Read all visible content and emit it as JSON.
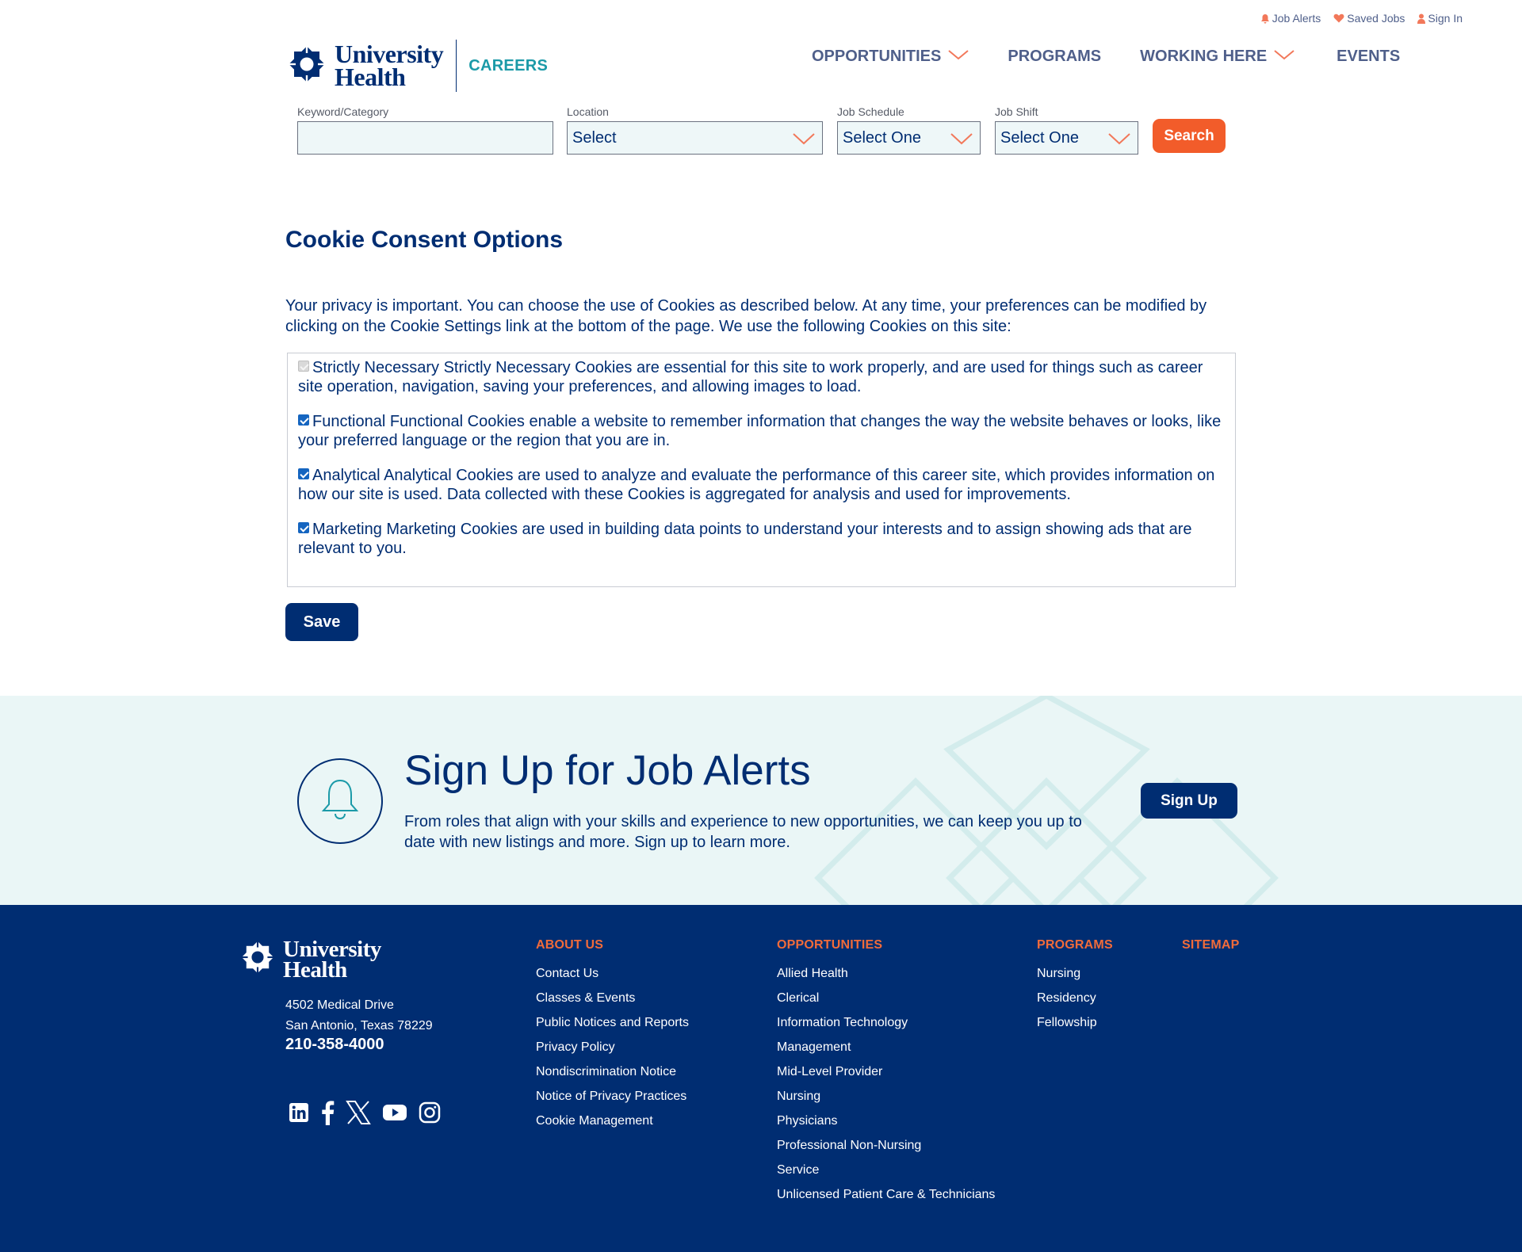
{
  "utility": {
    "job_alerts": "Job Alerts",
    "saved_jobs": "Saved Jobs",
    "sign_in": "Sign In"
  },
  "brand": {
    "name_line1": "University",
    "name_line2": "Health",
    "section": "CAREERS"
  },
  "nav": {
    "items": [
      {
        "label": "OPPORTUNITIES",
        "has_dropdown": true
      },
      {
        "label": "PROGRAMS",
        "has_dropdown": false
      },
      {
        "label": "WORKING HERE",
        "has_dropdown": true
      },
      {
        "label": "EVENTS",
        "has_dropdown": false
      }
    ]
  },
  "search": {
    "keyword": {
      "label": "Keyword/Category",
      "value": ""
    },
    "location": {
      "label": "Location",
      "value": "Select"
    },
    "schedule": {
      "label": "Job Schedule",
      "value": "Select One"
    },
    "shift": {
      "label": "Job Shift",
      "value": "Select One"
    },
    "button": "Search"
  },
  "cookies": {
    "title": "Cookie Consent Options",
    "intro": "Your privacy is important. You can choose the use of Cookies as described below. At any time, your preferences can be modified by clicking on the Cookie Settings link at the bottom of the page. We use the following Cookies on this site:",
    "options": [
      {
        "name": "Strictly Necessary",
        "description": "Strictly Necessary Cookies are essential for this site to work properly, and are used for things such as career site operation, navigation, saving your preferences, and allowing images to load.",
        "checked": true,
        "disabled": true
      },
      {
        "name": "Functional",
        "description": "Functional Cookies enable a website to remember information that changes the way the website behaves or looks, like your preferred language or the region that you are in.",
        "checked": true,
        "disabled": false
      },
      {
        "name": "Analytical",
        "description": "Analytical Cookies are used to analyze and evaluate the performance of this career site, which provides information on how our site is used. Data collected with these Cookies is aggregated for analysis and used for improvements.",
        "checked": true,
        "disabled": false
      },
      {
        "name": "Marketing",
        "description": "Marketing Cookies are used in building data points to understand your interests and to assign showing ads that are relevant to you.",
        "checked": true,
        "disabled": false
      }
    ],
    "save": "Save"
  },
  "alerts": {
    "title": "Sign Up for Job Alerts",
    "text": "From roles that align with your skills and experience to new opportunities, we can keep you up to date with new listings and more. Sign up to learn more.",
    "button": "Sign Up"
  },
  "footer": {
    "address_line1": "4502 Medical Drive",
    "address_line2": "San Antonio, Texas 78229",
    "phone": "210-358-4000",
    "social": [
      "linkedin-icon",
      "facebook-icon",
      "x-icon",
      "youtube-icon",
      "instagram-icon"
    ],
    "about": {
      "heading": "ABOUT US",
      "links": [
        "Contact Us",
        "Classes & Events",
        "Public Notices and Reports",
        "Privacy Policy",
        "Nondiscrimination Notice",
        "Notice of Privacy Practices",
        "Cookie Management"
      ]
    },
    "opportunities": {
      "heading": "OPPORTUNITIES",
      "links": [
        "Allied Health",
        "Clerical",
        "Information Technology",
        "Management",
        "Mid-Level Provider",
        "Nursing",
        "Physicians",
        "Professional Non-Nursing",
        "Service",
        "Unlicensed Patient Care & Technicians"
      ]
    },
    "programs": {
      "heading": "PROGRAMS",
      "links": [
        "Nursing",
        "Residency",
        "Fellowship"
      ]
    },
    "sitemap": {
      "heading": "SITEMAP"
    }
  },
  "colors": {
    "navy": "#002d72",
    "teal": "#1b9aa8",
    "orange": "#f25c2a",
    "alert_bg": "#eaf6f6"
  }
}
